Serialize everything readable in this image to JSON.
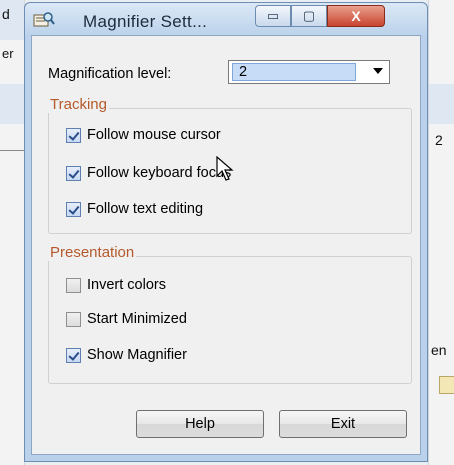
{
  "background": {
    "left_texts": [
      "d",
      "er"
    ],
    "right_texts": [
      "2",
      "en"
    ]
  },
  "window": {
    "title": "Magnifier Sett...",
    "caption_buttons": {
      "minimize": "▭",
      "maximize": "▢",
      "close": "X"
    }
  },
  "magnification": {
    "label": "Magnification level:",
    "value": "2"
  },
  "tracking": {
    "title": "Tracking",
    "options": [
      {
        "label": "Follow mouse cursor",
        "checked": true
      },
      {
        "label": "Follow keyboard focus",
        "checked": true
      },
      {
        "label": "Follow text editing",
        "checked": true
      }
    ]
  },
  "presentation": {
    "title": "Presentation",
    "options": [
      {
        "label": "Invert colors",
        "checked": false
      },
      {
        "label": "Start Minimized",
        "checked": false
      },
      {
        "label": "Show Magnifier",
        "checked": true
      }
    ]
  },
  "buttons": {
    "help": "Help",
    "exit": "Exit"
  }
}
